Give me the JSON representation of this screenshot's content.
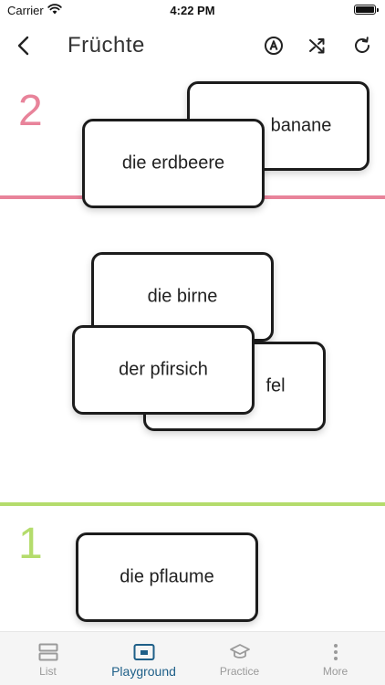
{
  "status_bar": {
    "carrier": "Carrier",
    "time": "4:22 PM"
  },
  "nav": {
    "title": "Früchte"
  },
  "levels": [
    {
      "number": "2",
      "color": "#e8839a"
    },
    {
      "number": "1",
      "color": "#b4dc6c"
    }
  ],
  "cards": [
    {
      "label": "die banane",
      "shown": "banane"
    },
    {
      "label": "die erdbeere"
    },
    {
      "label": "die birne"
    },
    {
      "label": "der apfel",
      "shown": "fel"
    },
    {
      "label": "der pfirsich"
    },
    {
      "label": "die pflaume"
    }
  ],
  "tabs": [
    {
      "label": "List",
      "icon": "list-icon",
      "active": false
    },
    {
      "label": "Playground",
      "icon": "playground-icon",
      "active": true
    },
    {
      "label": "Practice",
      "icon": "graduation-cap-icon",
      "active": false
    },
    {
      "label": "More",
      "icon": "more-vertical-icon",
      "active": false
    }
  ],
  "colors": {
    "active_tab": "#1e5f88",
    "inactive_tab": "#9a9a9a",
    "card_border": "#1c1c1c"
  }
}
